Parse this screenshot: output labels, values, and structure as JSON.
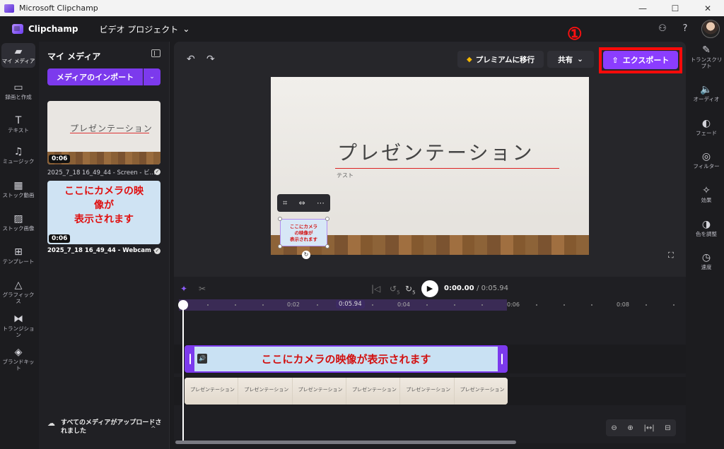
{
  "window": {
    "title": "Microsoft Clipchamp",
    "min": "—",
    "max": "☐",
    "close": "✕"
  },
  "header": {
    "brand": "Clipchamp",
    "project": "ビデオ プロジェクト",
    "project_caret": "⌄",
    "share_icon": "⚇",
    "help": "?"
  },
  "leftnav": [
    {
      "icon": "▰",
      "label": "マイ メディア",
      "name": "folder-icon"
    },
    {
      "icon": "▭",
      "label": "録画と作成",
      "name": "camera-icon"
    },
    {
      "icon": "T",
      "label": "テキスト",
      "name": "text-icon"
    },
    {
      "icon": "♫",
      "label": "ミュージック",
      "name": "music-icon"
    },
    {
      "icon": "▦",
      "label": "ストック動画",
      "name": "film-icon"
    },
    {
      "icon": "▨",
      "label": "ストック画像",
      "name": "image-icon"
    },
    {
      "icon": "⊞",
      "label": "テンプレート",
      "name": "template-icon"
    },
    {
      "icon": "△",
      "label": "グラフィックス",
      "name": "shapes-icon"
    },
    {
      "icon": "⧓",
      "label": "トランジション",
      "name": "transition-icon"
    },
    {
      "icon": "◈",
      "label": "ブランドキット",
      "name": "brand-kit-icon"
    }
  ],
  "media": {
    "title": "マイ メディア",
    "import_label": "メディアのインポート",
    "import_caret": "⌄",
    "items": [
      {
        "thumb_title": "プレゼンテーション",
        "duration": "0:06",
        "filename_prefix": "2025_7_18 16_49_44 - Screen - ビ..."
      },
      {
        "thumb_text": "ここにカメラの映像が表示されます",
        "thumb_lines": [
          "ここにカメラの映",
          "像が",
          "表示されます"
        ],
        "duration": "0:06",
        "filename": "2025_7_18 16_49_44 - Webcam - ..."
      }
    ],
    "approve_text": "すべてのメディアがアップロードされました",
    "approve_caret": "^"
  },
  "stage": {
    "undo": "↶",
    "redo": "↷",
    "premium_label": "プレミアムに移行",
    "share_label": "共有",
    "share_caret": "⌄",
    "export_label": "エクスポート",
    "step_badge": "①",
    "slide_title": "プレゼンテーション",
    "slide_subtitle": "テスト",
    "cam_overlay_lines": [
      "ここにカメラ",
      "の映像が",
      "表示されます"
    ],
    "tools": [
      "⌗",
      "⇔",
      "⋯"
    ],
    "fullscreen": "⛶",
    "rotate": "↻"
  },
  "rightnav": [
    {
      "icon": "✎",
      "label": "トランスクリプト",
      "name": "transcript-icon"
    },
    {
      "icon": "🔈",
      "label": "オーディオ",
      "name": "audio-icon"
    },
    {
      "icon": "◐",
      "label": "フェード",
      "name": "fade-icon"
    },
    {
      "icon": "◎",
      "label": "フィルター",
      "name": "filter-icon"
    },
    {
      "icon": "✧",
      "label": "効果",
      "name": "effects-icon"
    },
    {
      "icon": "◑",
      "label": "色を調整",
      "name": "color-adjust-icon"
    },
    {
      "icon": "◷",
      "label": "速度",
      "name": "speed-icon"
    }
  ],
  "timeline": {
    "current_time": "0:00.00",
    "total_time": "/ 0:05.94",
    "playhead_label": "0:05.94",
    "ticks": [
      "0:02",
      "0:04",
      "0:06",
      "0:08"
    ],
    "play": "▶",
    "skip_back": "|◁",
    "rewind": "↺",
    "forward": "↻",
    "rewind_num": "5",
    "forward_num": "5",
    "magic": "✦",
    "cut": "✂",
    "cam_clip_label": "ここにカメラの映像が表示されます",
    "slide_frame_label": "プレゼンテーション",
    "zoom_out": "⊖",
    "zoom_in": "⊕",
    "fit": "|↔|",
    "expand": "⊟"
  },
  "colors": {
    "accent": "#7c3aed",
    "export": "#8b3dff",
    "highlight": "#ff0a0a"
  }
}
